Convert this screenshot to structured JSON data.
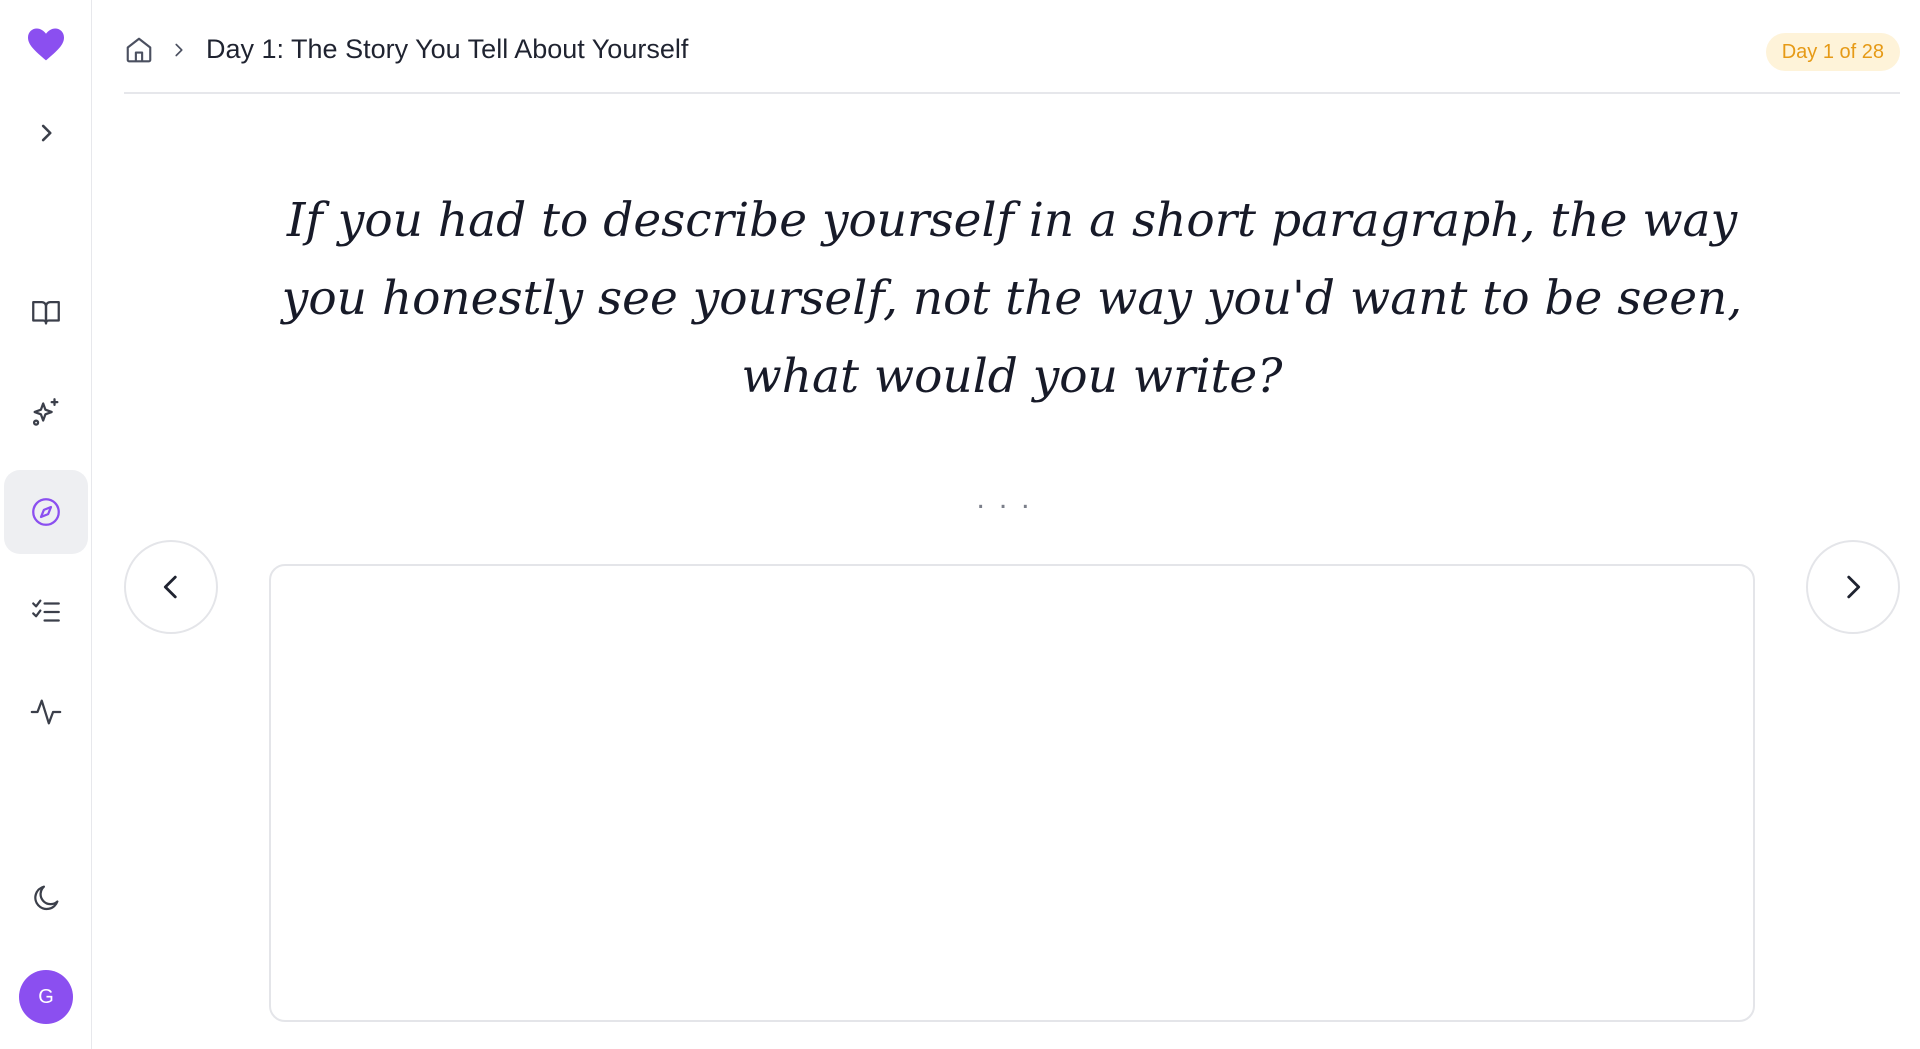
{
  "sidebar": {
    "logo": "heart-icon",
    "expand": "chevron-right-icon",
    "items": [
      {
        "icon": "book-open-icon",
        "active": false
      },
      {
        "icon": "sparkles-icon",
        "active": false
      },
      {
        "icon": "compass-icon",
        "active": true
      },
      {
        "icon": "checklist-icon",
        "active": false
      },
      {
        "icon": "activity-icon",
        "active": false
      }
    ],
    "theme_toggle": "moon-icon",
    "avatar_initial": "G"
  },
  "header": {
    "home_icon": "home-icon",
    "title": "Day 1: The Story You Tell About Yourself",
    "badge": "Day 1 of 28"
  },
  "prompt": {
    "text": "If you had to describe yourself in a short paragraph, the way you honestly see yourself, not the way you'd want to be seen, what would you write?",
    "separator": "..."
  },
  "response": {
    "value": "",
    "placeholder": ""
  },
  "colors": {
    "brand": "#8b4ff0",
    "badge_bg": "#fef3d9",
    "badge_text": "#e69a16"
  }
}
